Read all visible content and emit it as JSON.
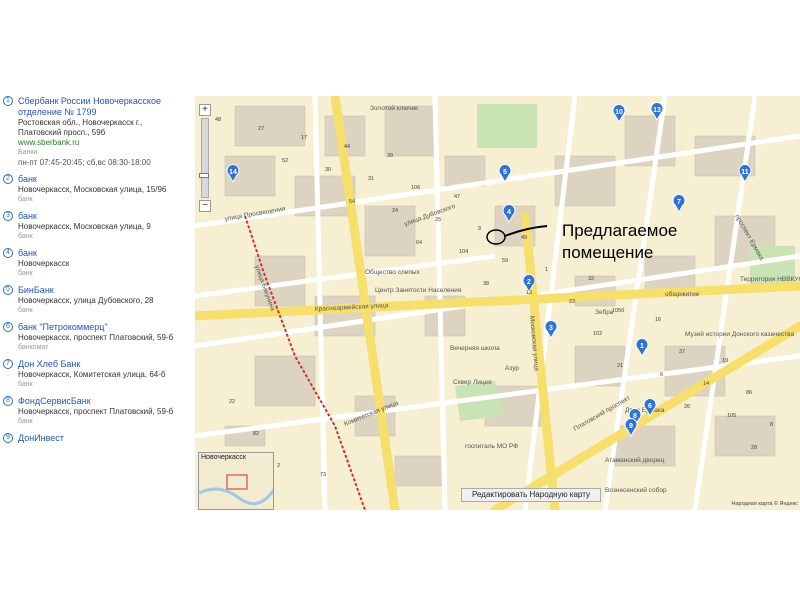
{
  "results": [
    {
      "num": "1",
      "title": "Сбербанк России Новочеркасское отделение № 1799",
      "address": "Ростовская обл., Новочеркасск г., Платовский просп., 59б",
      "link": "www.sberbank.ru",
      "category": "Банки",
      "hours": "пн-пт 07:45-20:45; сб,вс 08:30-18:00"
    },
    {
      "num": "2",
      "title": "банк",
      "address": "Новочеркасск, Московская улица, 15/96",
      "category": "банк"
    },
    {
      "num": "3",
      "title": "банк",
      "address": "Новочеркасск, Московская улица, 9",
      "category": "банк"
    },
    {
      "num": "4",
      "title": "банк",
      "address": "Новочеркасск",
      "category": "банк"
    },
    {
      "num": "5",
      "title": "БинБанк",
      "address": "Новочеркасск, улица Дубовского, 28",
      "category": "банк"
    },
    {
      "num": "6",
      "title": "банк \"Петрокоммерц\"",
      "address": "Новочеркасск, проспект Платовский, 59-б",
      "category": "банкомат"
    },
    {
      "num": "7",
      "title": "Дон Хлеб Банк",
      "address": "Новочеркасск, Комитетская улица, 64-б",
      "category": "банк"
    },
    {
      "num": "8",
      "title": "ФондСервисБанк",
      "address": "Новочеркасск, проспект Платовский, 59-б",
      "category": "банк"
    },
    {
      "num": "9",
      "title": "ДонИнвест",
      "address": "",
      "category": ""
    }
  ],
  "map": {
    "callout": [
      "Предлагаемое",
      "помещение"
    ],
    "edit_button": "Редактировать Народную карту",
    "minimap_label": "Новочеркасск",
    "copyright": "Народная карта © Яндекс",
    "zoom_in": "+",
    "zoom_out": "−",
    "streets": [
      "улица Дубовского",
      "Красноармейская улица",
      "Комитетская улица",
      "Московская улица",
      "Платовский проспект",
      "проспект Ермака",
      "улица Просвещения",
      "улица Бакунина"
    ],
    "places": [
      "Общество слепых",
      "Центр Занятости Населения",
      "Зебра",
      "Вечерняя школа",
      "Азур",
      "Сквер Лицея",
      "госпиталь МО РФ",
      "Атаманский дворец",
      "Двор Ермака",
      "Вознесенский собор",
      "Территория НВВКУС",
      "общежитие",
      "Музей истории Донского казачества",
      "Золотой ключик"
    ],
    "house_numbers": [
      "48",
      "52",
      "54",
      "64",
      "38",
      "42",
      "21",
      "26",
      "28",
      "27",
      "30",
      "24",
      "104",
      "13",
      "102",
      "6",
      "105",
      "15",
      "17",
      "31",
      "25",
      "59",
      "23",
      "12",
      "14",
      "8",
      "2",
      "44",
      "106",
      "9",
      "1",
      "105б",
      "37",
      "86",
      "82",
      "73",
      "39",
      "47",
      "49",
      "32",
      "16",
      "19",
      "22"
    ],
    "markers": [
      {
        "label": "1",
        "color": "#2f73d9"
      },
      {
        "label": "2",
        "color": "#2f73d9"
      },
      {
        "label": "3",
        "color": "#2f73d9"
      },
      {
        "label": "4",
        "color": "#2f73d9"
      },
      {
        "label": "5",
        "color": "#2f73d9"
      },
      {
        "label": "6",
        "color": "#2f73d9"
      },
      {
        "label": "7",
        "color": "#2f73d9"
      },
      {
        "label": "8",
        "color": "#2f73d9"
      },
      {
        "label": "9",
        "color": "#2f73d9"
      },
      {
        "label": "10",
        "color": "#2f73d9"
      },
      {
        "label": "11",
        "color": "#2f73d9"
      },
      {
        "label": "13",
        "color": "#2f73d9"
      },
      {
        "label": "14",
        "color": "#2f73d9"
      }
    ],
    "colors": {
      "road": "#ffffff",
      "main_road": "#f7df6d",
      "park": "#c9e3b5",
      "building": "#d9d2c2",
      "water": "#9fc7e8",
      "route": "#d0322b"
    }
  }
}
